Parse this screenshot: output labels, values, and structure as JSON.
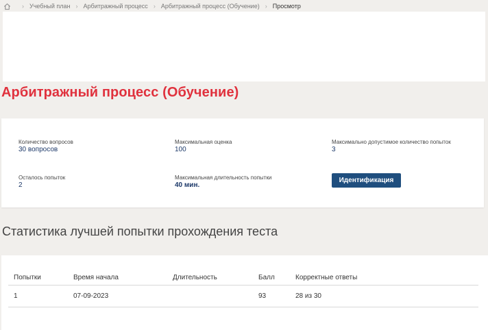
{
  "breadcrumb": {
    "items": [
      "Учебный план",
      "Арбитражный процесс",
      "Арбитражный процесс (Обучение)",
      "Просмотр"
    ]
  },
  "page": {
    "title": "Арбитражный процесс (Обучение)"
  },
  "info": {
    "questions_label": "Количество вопросов",
    "questions_value": "30 вопросов",
    "max_score_label": "Максимальная оценка",
    "max_score_value": "100",
    "max_attempts_label": "Максимально допустимое количество попыток",
    "max_attempts_value": "3",
    "remaining_label": "Осталось попыток",
    "remaining_value": "2",
    "max_duration_label": "Максимальная длительность попытки",
    "max_duration_value": "40 мин.",
    "ident_button": "Идентификация"
  },
  "stats": {
    "title": "Статистика лучшей попытки прохождения теста",
    "columns": [
      "Попытки",
      "Время начала",
      "Длительность",
      "Балл",
      "Корректные ответы"
    ],
    "rows": [
      [
        "1",
        "07-09-2023",
        "",
        "93",
        "28 из 30"
      ]
    ]
  },
  "colors": {
    "title_red": "#e0313d",
    "button_blue": "#1f4e7e",
    "background": "#f1efec"
  },
  "icons": {
    "home": "home-icon",
    "separator": "chevron-right-icon"
  }
}
